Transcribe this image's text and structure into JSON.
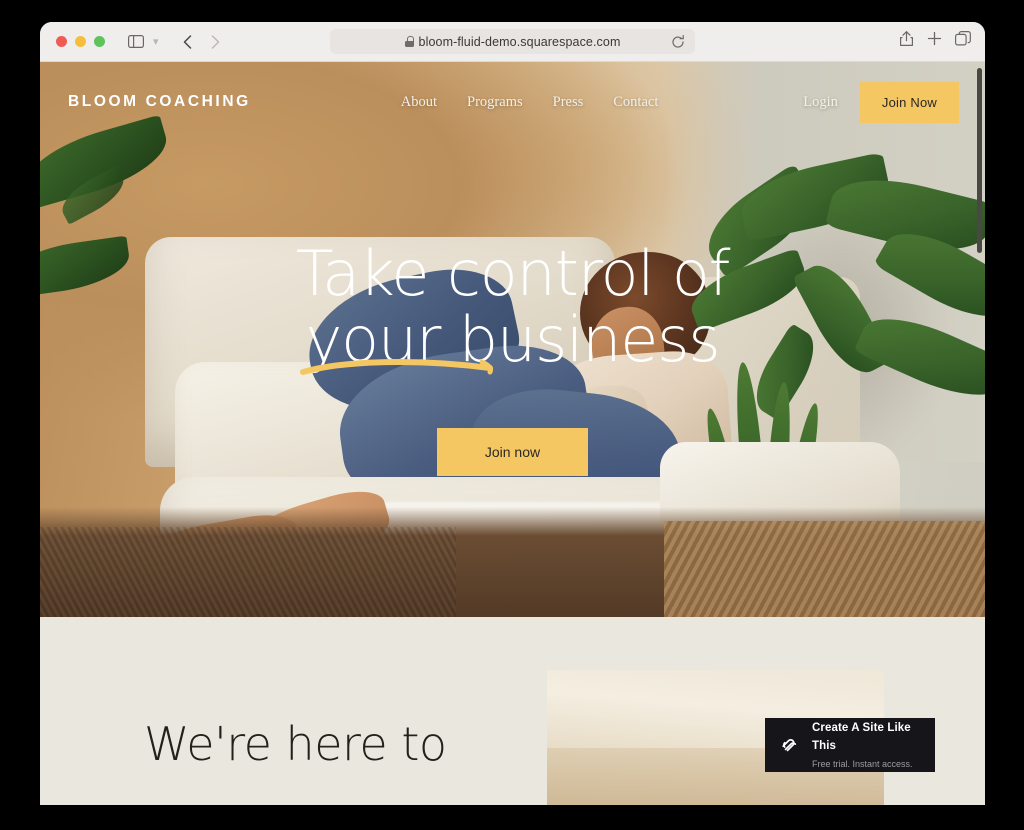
{
  "browser": {
    "url": "bloom-fluid-demo.squarespace.com",
    "lock_icon": "lock-icon",
    "reload_icon": "reload-icon",
    "sidebar_icon": "sidebar-toggle-icon",
    "chevron_icon": "chevron-down-icon",
    "back_icon": "back-arrow-icon",
    "forward_icon": "forward-arrow-icon",
    "share_icon": "share-icon",
    "newtab_icon": "plus-icon",
    "tabs_icon": "tab-overview-icon",
    "traffic_lights": [
      "close",
      "minimize",
      "maximize"
    ]
  },
  "site": {
    "brand": "BLOOM COACHING",
    "nav": [
      {
        "label": "About"
      },
      {
        "label": "Programs"
      },
      {
        "label": "Press"
      },
      {
        "label": "Contact"
      }
    ],
    "login_label": "Login",
    "join_button": "Join Now",
    "hero": {
      "headline_line1": "Take control of",
      "headline_line2": "your business",
      "cta_label": "Join now",
      "accent_color": "#f5c763"
    },
    "section2": {
      "heading": "We're here to"
    }
  },
  "badge": {
    "title": "Create A Site Like This",
    "subtitle": "Free trial. Instant access.",
    "logo_icon": "squarespace-logo-icon"
  }
}
